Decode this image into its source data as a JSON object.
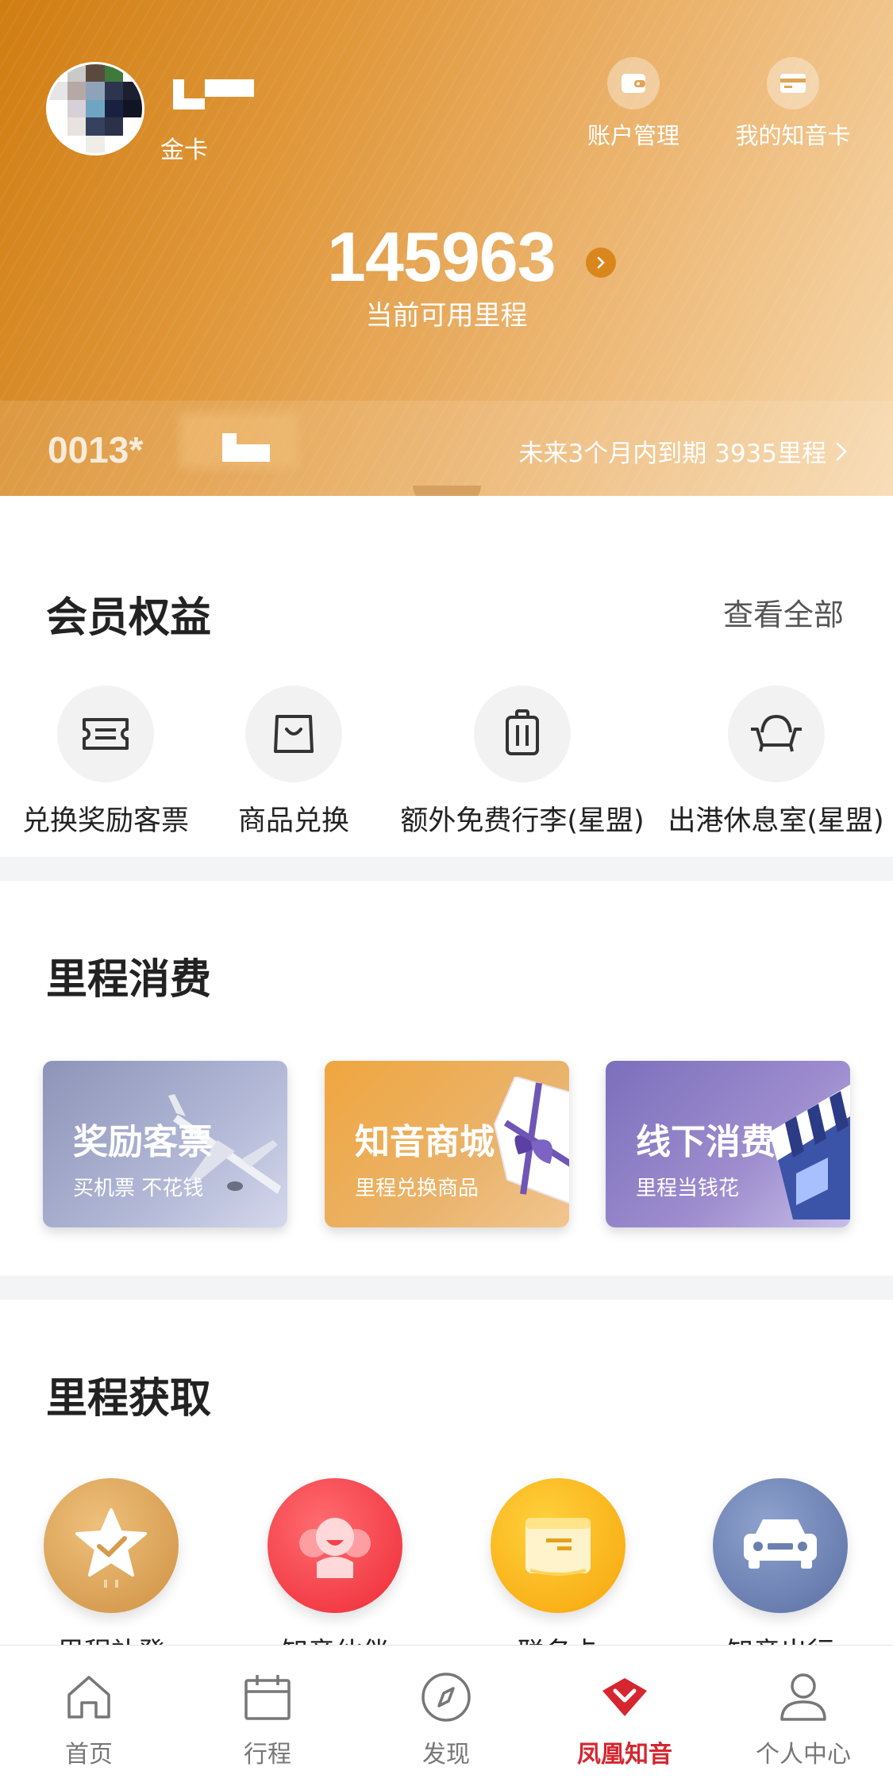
{
  "header": {
    "card_level": "金卡",
    "actions": [
      {
        "label": "账户管理",
        "icon": "wallet-icon"
      },
      {
        "label": "我的知音卡",
        "icon": "card-icon"
      }
    ],
    "miles_value": "145963",
    "miles_label": "当前可用里程",
    "card_number": "0013*",
    "expire_text": "未来3个月内到期 3935里程"
  },
  "benefits": {
    "title": "会员权益",
    "view_all": "查看全部",
    "items": [
      {
        "label": "兑换奖励客票",
        "icon": "ticket-icon"
      },
      {
        "label": "商品兑换",
        "icon": "shopping-bag-icon"
      },
      {
        "label": "额外免费行李(星盟)",
        "icon": "luggage-icon"
      },
      {
        "label": "出港休息室(星盟)",
        "icon": "lounge-icon"
      }
    ]
  },
  "consume": {
    "title": "里程消费",
    "cards": [
      {
        "title": "奖励客票",
        "subtitle": "买机票 不花钱"
      },
      {
        "title": "知音商城",
        "subtitle": "里程兑换商品"
      },
      {
        "title": "线下消费",
        "subtitle": "里程当钱花"
      }
    ]
  },
  "earn": {
    "title": "里程获取",
    "items": [
      {
        "label": "里程补登",
        "icon": "star-check-icon",
        "color": "#d9a04f"
      },
      {
        "label": "知音伙伴",
        "icon": "partner-icon",
        "color": "#f03e45"
      },
      {
        "label": "联名卡",
        "icon": "cobrand-card-icon",
        "color": "#f7b21c"
      },
      {
        "label": "知音出行",
        "icon": "car-icon",
        "color": "#6a7fae"
      }
    ]
  },
  "tabbar": {
    "items": [
      {
        "label": "首页",
        "icon": "home-icon"
      },
      {
        "label": "行程",
        "icon": "calendar-icon"
      },
      {
        "label": "发现",
        "icon": "compass-icon"
      },
      {
        "label": "凤凰知音",
        "icon": "phoenix-icon"
      },
      {
        "label": "个人中心",
        "icon": "person-icon"
      }
    ],
    "active_index": 3,
    "active_color": "#d6262f"
  }
}
